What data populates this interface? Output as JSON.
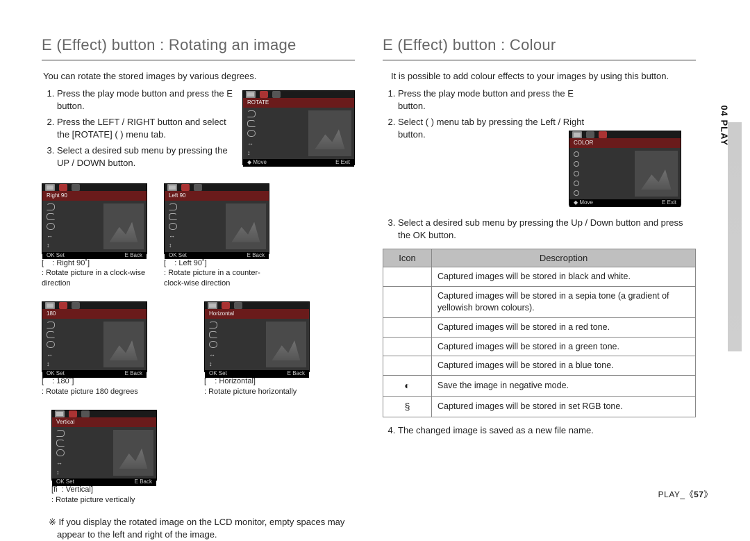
{
  "left": {
    "heading": "E (Effect) button : Rotating an image",
    "intro": "You can rotate the stored images by various degrees.",
    "steps": [
      "Press the play mode button and press the E button.",
      "Press the LEFT / RIGHT button and select the [ROTATE] (      ) menu tab.",
      "Select a desired sub menu by pressing the UP / DOWN button."
    ],
    "lcd_main": {
      "title": "ROTATE",
      "bl": "Move",
      "bll": "◆",
      "br": "Exit",
      "brk": "E"
    },
    "options": [
      {
        "title": "Right 90",
        "cap_icon": "",
        "cap_t": ": Right 90˚",
        "cap_sub": ": Rotate picture in a clock-wise direction",
        "bl": "Set",
        "bll": "OK",
        "br": "Back",
        "brk": "E"
      },
      {
        "title": "Left 90",
        "cap_icon": "",
        "cap_t": ": Left 90˚",
        "cap_sub": ": Rotate picture in a counter-clock-wise direction",
        "bl": "Set",
        "bll": "OK",
        "br": "Back",
        "brk": "E"
      },
      {
        "title": "180",
        "cap_icon": "",
        "cap_t": ": 180˚",
        "cap_sub": ": Rotate picture 180 degrees",
        "bl": "Set",
        "bll": "OK",
        "br": "Back",
        "brk": "E"
      },
      {
        "title": "Horizontal",
        "cap_icon": "",
        "cap_t": ": Horizontal",
        "cap_sub": ": Rotate picture horizontally",
        "bl": "Set",
        "bll": "OK",
        "br": "Back",
        "brk": "E"
      },
      {
        "title": "Vertical",
        "cap_icon": "fi",
        "cap_t": ": Vertical",
        "cap_sub": ": Rotate picture vertically",
        "bl": "Set",
        "bll": "OK",
        "br": "Back",
        "brk": "E"
      }
    ],
    "note": "※ If you display the rotated image on the LCD monitor, empty spaces may appear to the left and right of the image."
  },
  "right": {
    "heading": "E (Effect) button : Colour",
    "intro": "It is possible to add colour effects to your images by using this button.",
    "steps12": [
      "Press the play mode button and press the E button.",
      "Select (       ) menu tab by pressing the Left / Right button."
    ],
    "lcd_color": {
      "title": "COLOR",
      "bl": "Move",
      "bll": "◆",
      "br": "Exit",
      "brk": "E"
    },
    "step3": "Select a desired sub menu by pressing the Up / Down button and press the OK button.",
    "table_head": {
      "icon": "Icon",
      "desc": "Descroption"
    },
    "rows": [
      {
        "icon": "",
        "desc": "Captured images will be stored in black and white."
      },
      {
        "icon": "",
        "desc": "Captured images will be stored in a sepia tone (a gradient of yellowish brown colours)."
      },
      {
        "icon": "",
        "desc": "Captured images will be stored in a red tone."
      },
      {
        "icon": "",
        "desc": "Captured images will be stored in a green tone."
      },
      {
        "icon": "",
        "desc": "Captured images will be stored in a blue tone."
      },
      {
        "icon": "◐",
        "desc": "Save the image in negative mode."
      },
      {
        "icon": "§",
        "desc": "Captured images will be stored in set RGB tone."
      }
    ],
    "step4": "The changed image is saved as a new file name."
  },
  "side_label": "04 PLAY",
  "footer_prefix": "PLAY_",
  "footer_page": "57"
}
